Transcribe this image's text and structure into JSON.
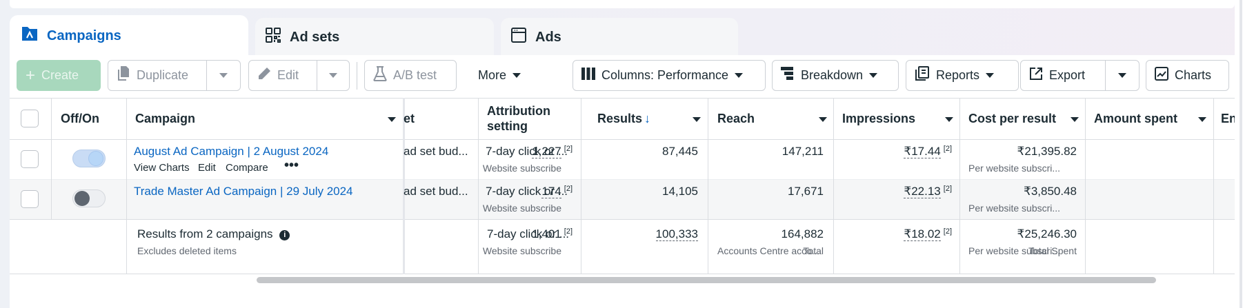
{
  "tabs": [
    {
      "label": "Campaigns",
      "icon": "campaign-folder-icon",
      "active": true
    },
    {
      "label": "Ad sets",
      "icon": "grid-icon",
      "active": false
    },
    {
      "label": "Ads",
      "icon": "ad-frame-icon",
      "active": false
    }
  ],
  "toolbar": {
    "create": "Create",
    "duplicate": "Duplicate",
    "edit": "Edit",
    "ab_test": "A/B test",
    "more": "More",
    "columns": "Columns: Performance",
    "breakdown": "Breakdown",
    "reports": "Reports",
    "export": "Export",
    "charts": "Charts"
  },
  "table": {
    "headers": {
      "off_on": "Off/On",
      "campaign": "Campaign",
      "budget_partial": "et",
      "attribution_line1": "Attribution",
      "attribution_line2": "setting",
      "results": "Results",
      "reach": "Reach",
      "impressions": "Impressions",
      "cost_per_result": "Cost per result",
      "amount_spent": "Amount spent",
      "ends_partial": "En"
    },
    "rows": [
      {
        "campaign": "August Ad Campaign | 2 August 2024",
        "actions": [
          "View Charts",
          "Edit",
          "Compare"
        ],
        "toggle": "on",
        "budget": "ad set bud...",
        "attribution": "7-day click or ...",
        "results": "1,227",
        "results_fn": "[2]",
        "results_sub": "Website subscribe",
        "reach": "87,445",
        "impressions": "147,211",
        "cost_per_result": "₹17.44",
        "cost_fn": "[2]",
        "cost_sub": "Per website subscri...",
        "amount_spent": "₹21,395.82"
      },
      {
        "campaign": "Trade Master Ad Campaign | 29 July 2024",
        "toggle": "off",
        "budget": "ad set bud...",
        "attribution": "7-day click or ...",
        "results": "174",
        "results_fn": "[2]",
        "results_sub": "Website subscribe",
        "reach": "14,105",
        "impressions": "17,671",
        "cost_per_result": "₹22.13",
        "cost_fn": "[2]",
        "cost_sub": "Per website subscri...",
        "amount_spent": "₹3,850.48"
      }
    ],
    "summary": {
      "title": "Results from 2 campaigns",
      "note": "Excludes deleted items",
      "attribution": "7-day click or ...",
      "results": "1,401",
      "results_fn": "[2]",
      "results_sub": "Website subscribe",
      "reach": "100,333",
      "reach_sub": "Accounts Centre acco...",
      "impressions": "164,882",
      "impressions_sub": "Total",
      "cost_per_result": "₹18.02",
      "cost_fn": "[2]",
      "cost_sub": "Per website subscri...",
      "amount_spent": "₹25,246.30",
      "amount_sub": "Total Spent"
    }
  },
  "colors": {
    "accent": "#0a66c2",
    "create_disabled": "#a8d8bd",
    "border": "#dadde1"
  }
}
